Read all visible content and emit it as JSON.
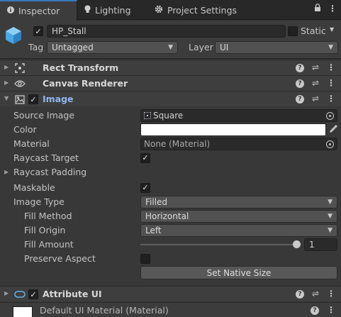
{
  "tabs": [
    {
      "label": "Inspector",
      "icon": "info-icon",
      "active": true
    },
    {
      "label": "Lighting",
      "icon": "lightbulb-icon",
      "active": false
    },
    {
      "label": "Project Settings",
      "icon": "gear-icon",
      "active": false
    }
  ],
  "header": {
    "object_name": "HP_Stall",
    "static_label": "Static",
    "tag_label": "Tag",
    "tag_value": "Untagged",
    "layer_label": "Layer",
    "layer_value": "UI"
  },
  "components": {
    "rect_transform": "Rect Transform",
    "canvas_renderer": "Canvas Renderer",
    "image": "Image",
    "attribute_ui": "Attribute UI"
  },
  "image_props": {
    "source_image_label": "Source Image",
    "source_image_value": "Square",
    "color_label": "Color",
    "color_value": "#ffffff",
    "material_label": "Material",
    "material_value": "None (Material)",
    "raycast_target_label": "Raycast Target",
    "raycast_padding_label": "Raycast Padding",
    "maskable_label": "Maskable",
    "image_type_label": "Image Type",
    "image_type_value": "Filled",
    "fill_method_label": "Fill Method",
    "fill_method_value": "Horizontal",
    "fill_origin_label": "Fill Origin",
    "fill_origin_value": "Left",
    "fill_amount_label": "Fill Amount",
    "fill_amount_value": "1",
    "preserve_aspect_label": "Preserve Aspect",
    "set_native_size": "Set Native Size"
  },
  "material_footer": "Default UI Material (Material)",
  "colors": {
    "accent": "#3a79bb",
    "link_title": "#8fb8ef"
  }
}
